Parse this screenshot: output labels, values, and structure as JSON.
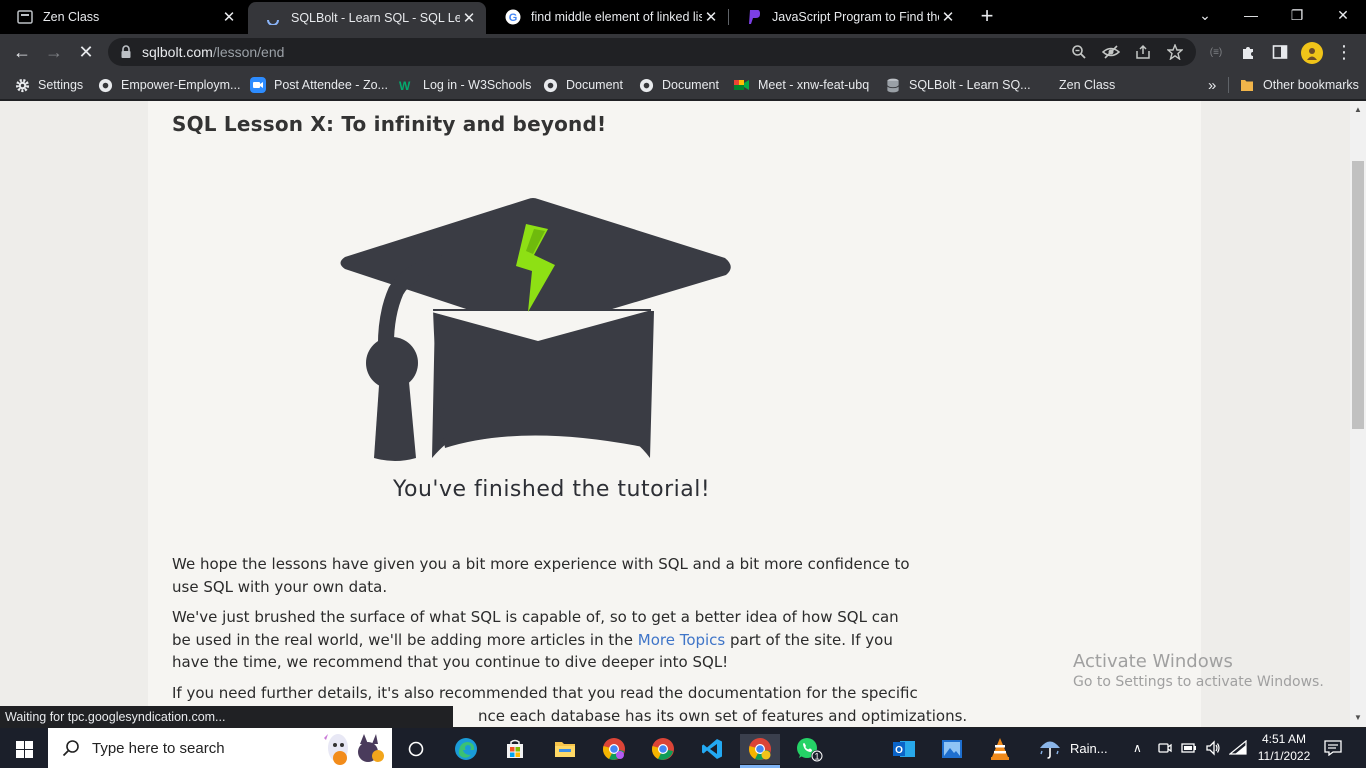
{
  "tabs": [
    {
      "title": "Zen Class",
      "close": "✕",
      "active": false
    },
    {
      "title": "SQLBolt - Learn SQL - SQL Lesson",
      "close": "✕",
      "active": true
    },
    {
      "title": "find middle element of linked list",
      "close": "✕",
      "active": false
    },
    {
      "title": "JavaScript Program to Find the Fa",
      "close": "✕",
      "active": false
    }
  ],
  "newtab_label": "+",
  "window_controls": {
    "minimize": "—",
    "restore": "❐",
    "close": "✕",
    "tabsearch": "⌄"
  },
  "toolbar": {
    "back": "←",
    "forward": "→",
    "stop": "✕",
    "url_host": "sqlbolt.com",
    "url_path": "/lesson/end"
  },
  "bookmarks": [
    {
      "label": "Settings",
      "icon": "gear-icon"
    },
    {
      "label": "Empower-Employm...",
      "icon": "chrome-icon"
    },
    {
      "label": "Post Attendee - Zo...",
      "icon": "zoom-icon"
    },
    {
      "label": "Log in - W3Schools",
      "icon": "w3schools-icon"
    },
    {
      "label": "Document",
      "icon": "chrome-icon"
    },
    {
      "label": "Document",
      "icon": "chrome-icon"
    },
    {
      "label": "Meet - xnw-feat-ubq",
      "icon": "meet-icon"
    },
    {
      "label": "SQLBolt - Learn SQ...",
      "icon": "database-icon"
    },
    {
      "label": "Zen Class",
      "icon": "blank-icon"
    }
  ],
  "bookmarks_overflow": "»",
  "other_bookmarks": "Other bookmarks",
  "page": {
    "lesson_title": "SQL Lesson X: To infinity and beyond!",
    "finished_text": "You've finished the tutorial!",
    "p1": "We hope the lessons have given you a bit more experience with SQL and a bit more confidence to use SQL with your own data.",
    "p2_before": "We've just brushed the surface of what SQL is capable of, so to get a better idea of how SQL can be used in the real world, we'll be adding more articles in the ",
    "p2_link": "More Topics",
    "p2_after": " part of the site. If you have the time, we recommend that you continue to dive deeper into SQL!",
    "p3_line1": "If you need further details, it's also recommended that you read the documentation for the specific",
    "p3_line2": "nce each database has its own set of features and optimizations."
  },
  "status_text": "Waiting for tpc.googlesyndication.com...",
  "activate": {
    "line1": "Activate Windows",
    "line2": "Go to Settings to activate Windows."
  },
  "taskbar": {
    "search_placeholder": "Type here to search",
    "weather": "Rain...",
    "time": "4:51 AM",
    "date": "11/1/2022",
    "whatsapp_badge": "1"
  },
  "colors": {
    "accent_link": "#3f75c8",
    "cap_dark": "#3a3c44",
    "bolt_green": "#8ee014"
  }
}
